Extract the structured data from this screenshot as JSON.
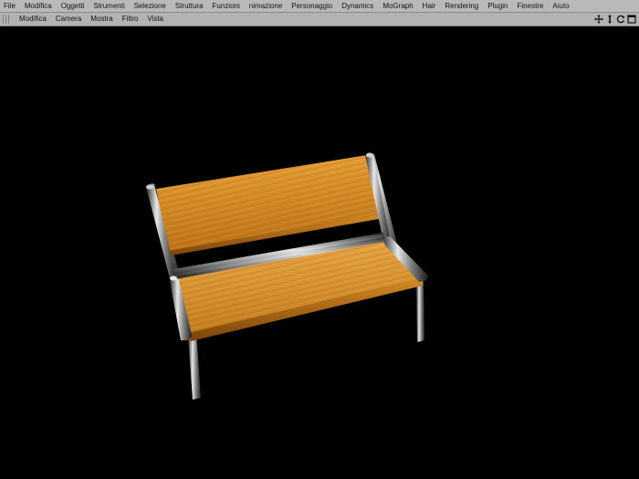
{
  "menubar": {
    "items": [
      "File",
      "Modifica",
      "Oggetti",
      "Strumenti",
      "Selezione",
      "Struttura",
      "Funzioni",
      "nimazione",
      "Personaggio",
      "Dynamics",
      "MoGraph",
      "Hair",
      "Rendering",
      "Plugin",
      "Finestre",
      "Aiuto"
    ]
  },
  "viewport": {
    "menu": [
      "Modifica",
      "Camera",
      "Mostra",
      "Filtro",
      "Vista"
    ],
    "controls": [
      "move-icon",
      "zoom-icon",
      "rotate-icon",
      "maximize-icon"
    ],
    "background_color": "#000000",
    "object": "bench",
    "colors": {
      "wood_light": "#e7a43a",
      "wood_dark": "#b86a12",
      "frame_light": "#e6e6e6",
      "frame_dark": "#3a3a3a"
    }
  }
}
